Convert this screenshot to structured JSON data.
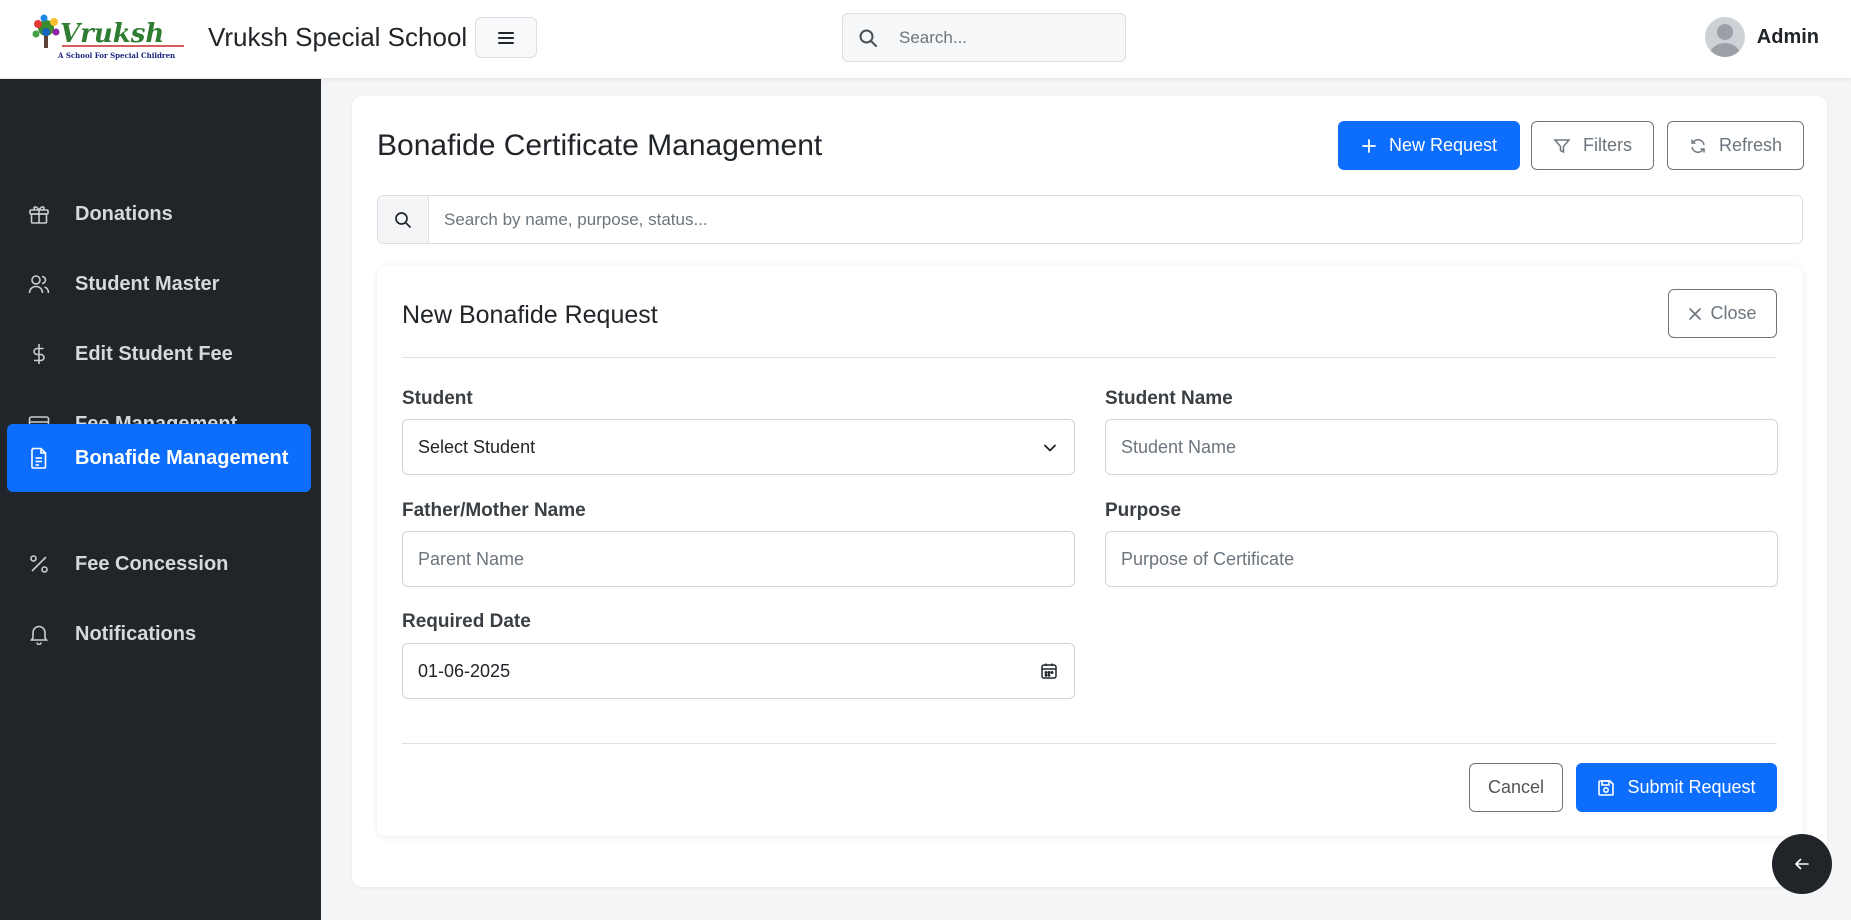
{
  "app": {
    "brand_title": "Vruksh Special School",
    "logo_text": "Vruksh",
    "logo_tagline": "A School For Special Children",
    "search_placeholder": "Search...",
    "user_name": "Admin"
  },
  "sidebar": {
    "items": [
      {
        "label": "Donations",
        "icon": "gift-icon",
        "active": false
      },
      {
        "label": "Student Master",
        "icon": "users-icon",
        "active": false
      },
      {
        "label": "Edit Student Fee",
        "icon": "dollar-icon",
        "active": false
      },
      {
        "label": "Fee Management",
        "icon": "credit-card-icon",
        "active": false
      },
      {
        "label": "Bonafide Management",
        "icon": "document-icon",
        "active": true
      },
      {
        "label": "Fee Concession",
        "icon": "percent-icon",
        "active": false
      },
      {
        "label": "Notifications",
        "icon": "bell-icon",
        "active": false
      }
    ]
  },
  "page": {
    "title": "Bonafide Certificate Management",
    "new_request_label": "New Request",
    "filters_label": "Filters",
    "refresh_label": "Refresh",
    "search_placeholder": "Search by name, purpose, status..."
  },
  "form": {
    "title": "New Bonafide Request",
    "close_label": "Close",
    "student_label": "Student",
    "student_value": "Select Student",
    "student_name_label": "Student Name",
    "student_name_placeholder": "Student Name",
    "parent_label": "Father/Mother Name",
    "parent_placeholder": "Parent Name",
    "purpose_label": "Purpose",
    "purpose_placeholder": "Purpose of Certificate",
    "date_label": "Required Date",
    "date_value": "01-06-2025",
    "cancel_label": "Cancel",
    "submit_label": "Submit Request"
  },
  "colors": {
    "primary": "#0d6efd",
    "sidebar_bg": "#212529",
    "page_bg": "#f4f5f7"
  }
}
